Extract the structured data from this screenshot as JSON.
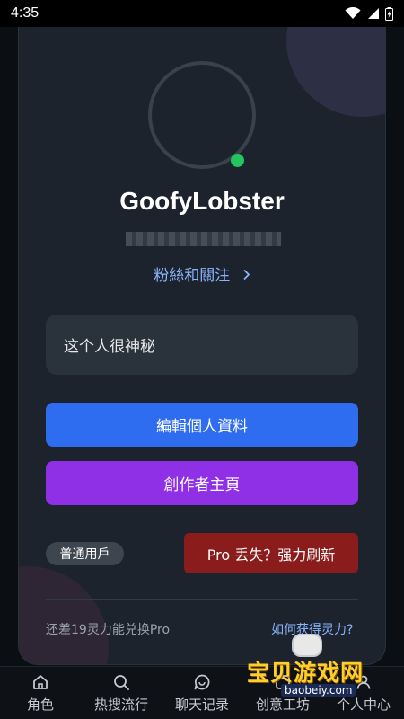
{
  "status_bar": {
    "time": "4:35"
  },
  "profile": {
    "username": "GoofyLobster",
    "followers_link": "粉絲和關注",
    "bio": "这个人很神秘"
  },
  "buttons": {
    "edit_profile": "編輯個人資料",
    "creator_home": "創作者主頁"
  },
  "account": {
    "badge": "普通用戶",
    "pro_button": "Pro 丢失？强力刷新",
    "points_message": "还差19灵力能兑换Pro",
    "howto_link": "如何获得灵力?"
  },
  "bottom_nav": {
    "items": [
      {
        "label": "角色",
        "icon": "home-icon"
      },
      {
        "label": "热搜流行",
        "icon": "search-icon"
      },
      {
        "label": "聊天记录",
        "icon": "chat-icon"
      },
      {
        "label": "创意工坊",
        "icon": "workshop-icon"
      },
      {
        "label": "个人中心",
        "icon": "profile-icon"
      }
    ]
  },
  "watermark": {
    "brand": "宝贝游戏网",
    "domain": "baobeiy.com"
  },
  "colors": {
    "accent_blue": "#2f6df0",
    "accent_purple": "#8f2fe6",
    "danger_red": "#8a1c1c",
    "online_green": "#22c55e",
    "link_blue": "#8ab4ff"
  }
}
